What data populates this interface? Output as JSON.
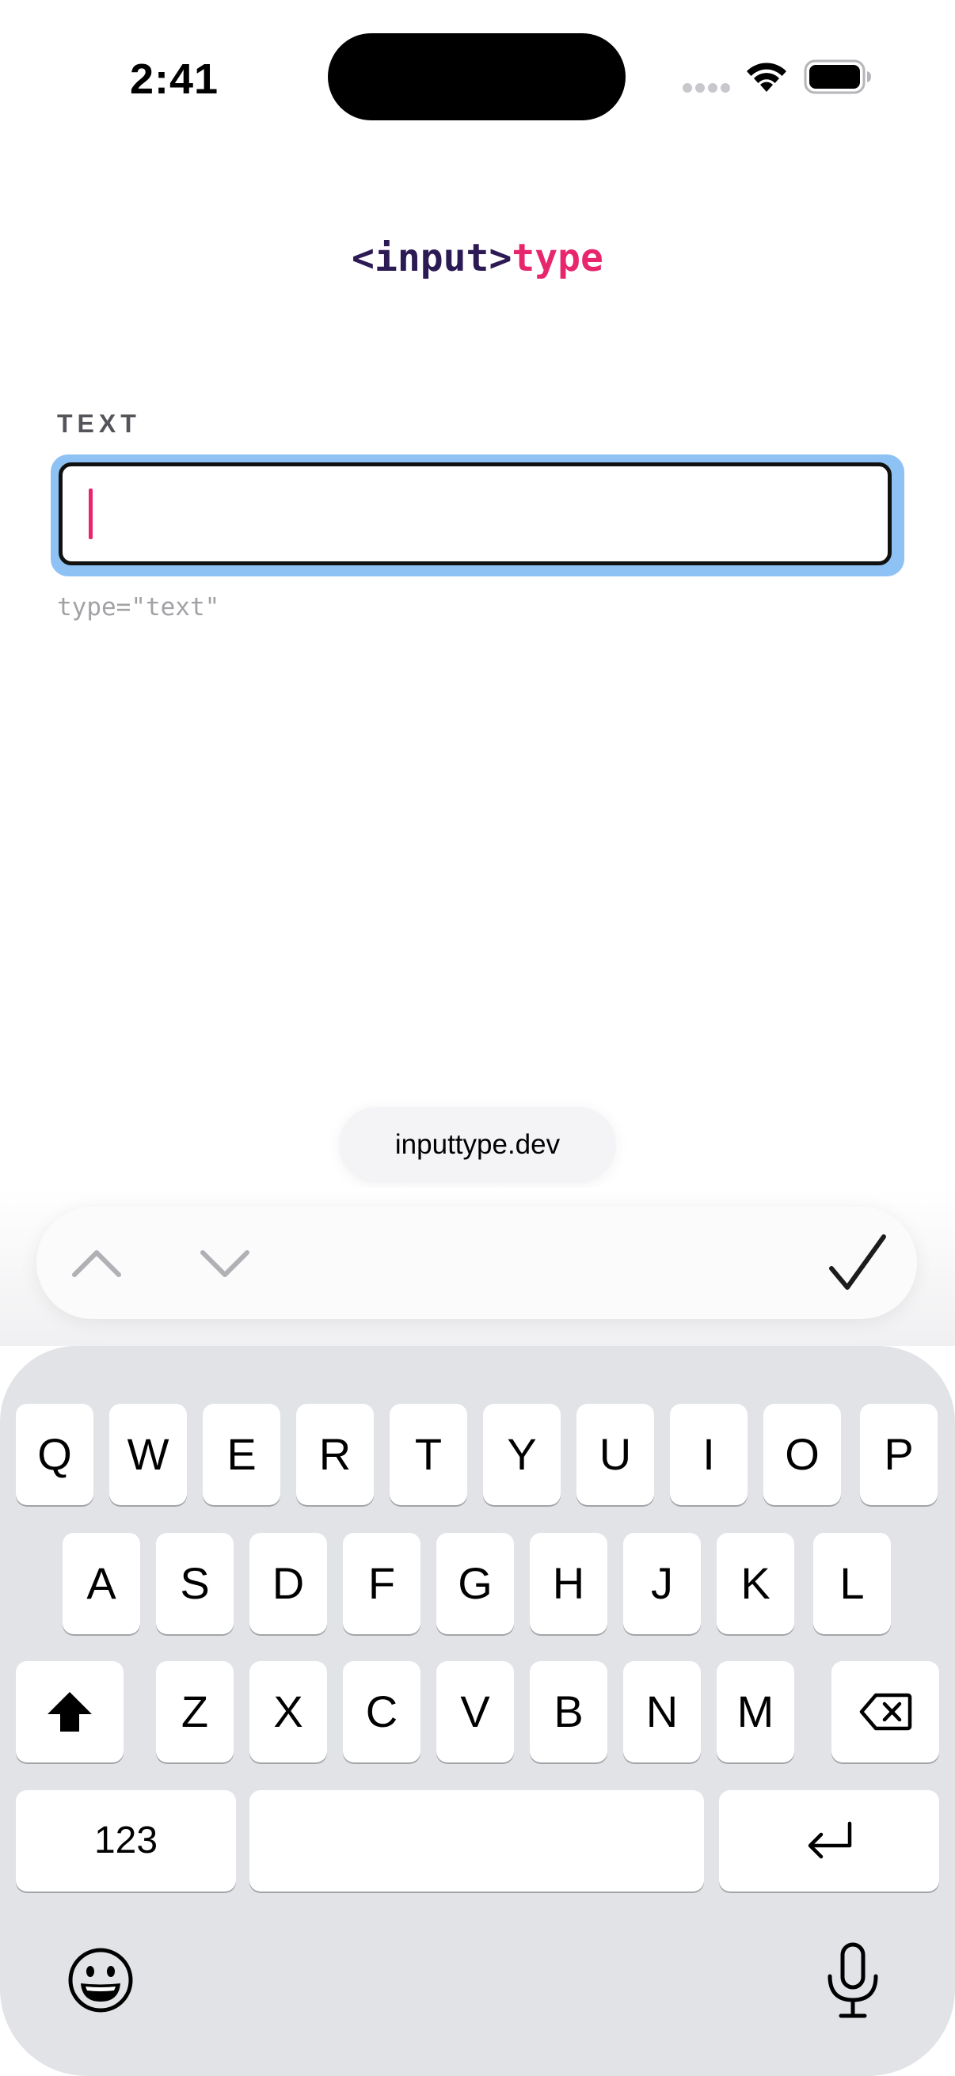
{
  "status_bar": {
    "time": "2:41"
  },
  "logo": {
    "tag": "<input>",
    "type": "type"
  },
  "field": {
    "label": "TEXT",
    "value": "",
    "hint": "type=\"text\""
  },
  "suggestion": {
    "text": "inputtype.dev"
  },
  "toolbar": {
    "icons": [
      "chevron-up-icon",
      "chevron-down-icon",
      "checkmark-icon"
    ]
  },
  "keyboard": {
    "row1": [
      "Q",
      "W",
      "E",
      "R",
      "T",
      "Y",
      "U",
      "I",
      "O",
      "P"
    ],
    "row2": [
      "A",
      "S",
      "D",
      "F",
      "G",
      "H",
      "J",
      "K",
      "L"
    ],
    "row3": [
      "Z",
      "X",
      "C",
      "V",
      "B",
      "N",
      "M"
    ],
    "numbers_key": "123",
    "space_key": "",
    "icons": [
      "shift-icon",
      "backspace-icon",
      "return-icon",
      "emoji-icon",
      "microphone-icon"
    ]
  },
  "colors": {
    "accent": "#e8266d",
    "logo_dark": "#2c1a55",
    "focus_ring": "#8ec2f4",
    "keyboard_bg": "#e2e3e7"
  }
}
